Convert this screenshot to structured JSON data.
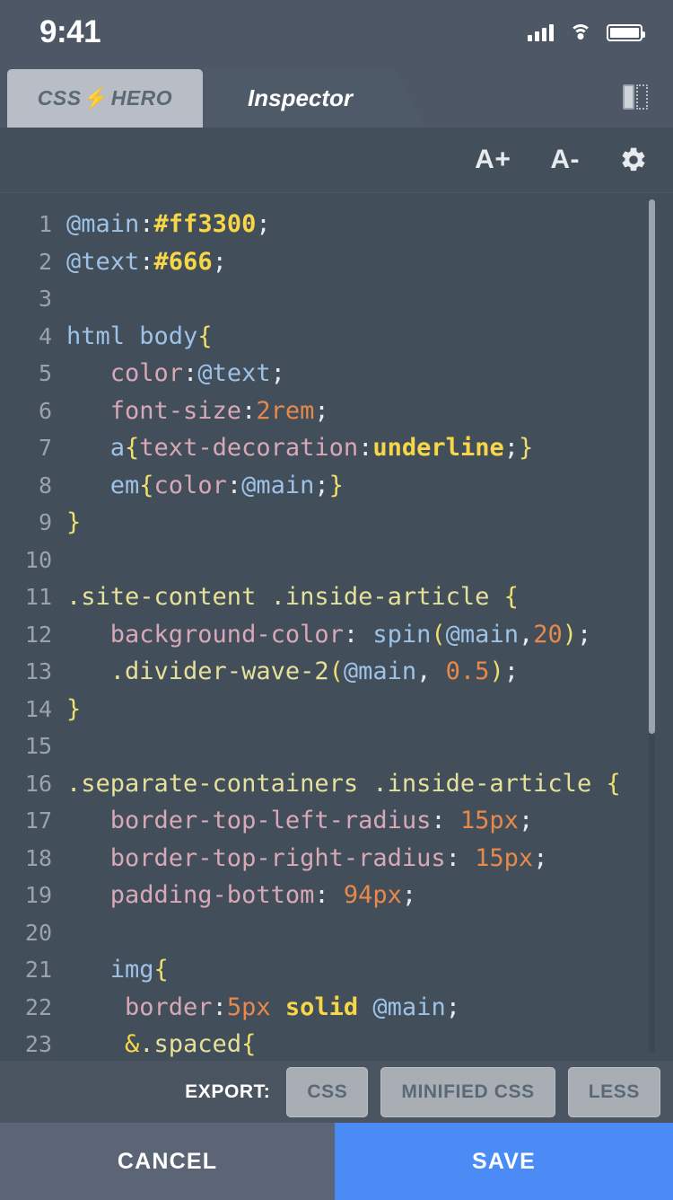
{
  "status_bar": {
    "time": "9:41",
    "icons": [
      "signal-bars-icon",
      "wifi-icon",
      "battery-icon"
    ]
  },
  "tabs": {
    "logo_prefix": "CSS",
    "logo_bolt": "⚡",
    "logo_suffix": "HERO",
    "active_tab": "Inspector",
    "panel_toggle_icon": "panel-layout-icon"
  },
  "toolbar": {
    "font_increase": "A+",
    "font_decrease": "A-",
    "settings_icon": "gear-icon"
  },
  "editor": {
    "lines": [
      {
        "n": "1",
        "tokens": [
          {
            "t": "@main",
            "c": "s-var"
          },
          {
            "t": ":",
            "c": "s-punct"
          },
          {
            "t": "#ff3300",
            "c": "s-hex"
          },
          {
            "t": ";",
            "c": "s-punct"
          }
        ]
      },
      {
        "n": "2",
        "tokens": [
          {
            "t": "@text",
            "c": "s-var"
          },
          {
            "t": ":",
            "c": "s-punct"
          },
          {
            "t": "#666",
            "c": "s-hex"
          },
          {
            "t": ";",
            "c": "s-punct"
          }
        ]
      },
      {
        "n": "3",
        "tokens": []
      },
      {
        "n": "4",
        "tokens": [
          {
            "t": "html body",
            "c": "s-tag"
          },
          {
            "t": "{",
            "c": "s-brace"
          }
        ]
      },
      {
        "n": "5",
        "tokens": [
          {
            "t": "   color",
            "c": "s-prop"
          },
          {
            "t": ":",
            "c": "s-punct"
          },
          {
            "t": "@text",
            "c": "s-var"
          },
          {
            "t": ";",
            "c": "s-punct"
          }
        ]
      },
      {
        "n": "6",
        "tokens": [
          {
            "t": "   font-size",
            "c": "s-prop"
          },
          {
            "t": ":",
            "c": "s-punct"
          },
          {
            "t": "2rem",
            "c": "s-num"
          },
          {
            "t": ";",
            "c": "s-punct"
          }
        ]
      },
      {
        "n": "7",
        "tokens": [
          {
            "t": "   a",
            "c": "s-tag"
          },
          {
            "t": "{",
            "c": "s-brace"
          },
          {
            "t": "text-decoration",
            "c": "s-prop"
          },
          {
            "t": ":",
            "c": "s-punct"
          },
          {
            "t": "underline",
            "c": "s-kw"
          },
          {
            "t": ";",
            "c": "s-punct"
          },
          {
            "t": "}",
            "c": "s-brace"
          }
        ]
      },
      {
        "n": "8",
        "tokens": [
          {
            "t": "   em",
            "c": "s-tag"
          },
          {
            "t": "{",
            "c": "s-brace"
          },
          {
            "t": "color",
            "c": "s-prop"
          },
          {
            "t": ":",
            "c": "s-punct"
          },
          {
            "t": "@main",
            "c": "s-var"
          },
          {
            "t": ";",
            "c": "s-punct"
          },
          {
            "t": "}",
            "c": "s-brace"
          }
        ]
      },
      {
        "n": "9",
        "tokens": [
          {
            "t": "}",
            "c": "s-brace"
          }
        ]
      },
      {
        "n": "10",
        "tokens": []
      },
      {
        "n": "11",
        "tokens": [
          {
            "t": ".site-content .inside-article ",
            "c": "s-sel"
          },
          {
            "t": "{",
            "c": "s-brace"
          }
        ]
      },
      {
        "n": "12",
        "tokens": [
          {
            "t": "   background-color",
            "c": "s-prop"
          },
          {
            "t": ": ",
            "c": "s-punct"
          },
          {
            "t": "spin",
            "c": "s-fn"
          },
          {
            "t": "(",
            "c": "s-brace"
          },
          {
            "t": "@main",
            "c": "s-var"
          },
          {
            "t": ",",
            "c": "s-punct"
          },
          {
            "t": "20",
            "c": "s-num"
          },
          {
            "t": ")",
            "c": "s-brace"
          },
          {
            "t": ";",
            "c": "s-punct"
          }
        ]
      },
      {
        "n": "13",
        "tokens": [
          {
            "t": "   .divider-wave-2",
            "c": "s-sel"
          },
          {
            "t": "(",
            "c": "s-brace"
          },
          {
            "t": "@main",
            "c": "s-var"
          },
          {
            "t": ", ",
            "c": "s-punct"
          },
          {
            "t": "0.5",
            "c": "s-num"
          },
          {
            "t": ")",
            "c": "s-brace"
          },
          {
            "t": ";",
            "c": "s-punct"
          }
        ]
      },
      {
        "n": "14",
        "tokens": [
          {
            "t": "}",
            "c": "s-brace"
          }
        ]
      },
      {
        "n": "15",
        "tokens": []
      },
      {
        "n": "16",
        "tokens": [
          {
            "t": ".separate-containers .inside-article ",
            "c": "s-sel"
          },
          {
            "t": "{",
            "c": "s-brace"
          }
        ]
      },
      {
        "n": "17",
        "tokens": [
          {
            "t": "   border-top-left-radius",
            "c": "s-prop"
          },
          {
            "t": ": ",
            "c": "s-punct"
          },
          {
            "t": "15px",
            "c": "s-num"
          },
          {
            "t": ";",
            "c": "s-punct"
          }
        ]
      },
      {
        "n": "18",
        "tokens": [
          {
            "t": "   border-top-right-radius",
            "c": "s-prop"
          },
          {
            "t": ": ",
            "c": "s-punct"
          },
          {
            "t": "15px",
            "c": "s-num"
          },
          {
            "t": ";",
            "c": "s-punct"
          }
        ]
      },
      {
        "n": "19",
        "tokens": [
          {
            "t": "   padding-bottom",
            "c": "s-prop"
          },
          {
            "t": ": ",
            "c": "s-punct"
          },
          {
            "t": "94px",
            "c": "s-num"
          },
          {
            "t": ";",
            "c": "s-punct"
          }
        ]
      },
      {
        "n": "20",
        "tokens": []
      },
      {
        "n": "21",
        "tokens": [
          {
            "t": "   img",
            "c": "s-tag"
          },
          {
            "t": "{",
            "c": "s-brace"
          }
        ]
      },
      {
        "n": "22",
        "tokens": [
          {
            "t": "    border",
            "c": "s-prop"
          },
          {
            "t": ":",
            "c": "s-punct"
          },
          {
            "t": "5px",
            "c": "s-num"
          },
          {
            "t": " ",
            "c": "s-punct"
          },
          {
            "t": "solid",
            "c": "s-kw"
          },
          {
            "t": " ",
            "c": "s-punct"
          },
          {
            "t": "@main",
            "c": "s-var"
          },
          {
            "t": ";",
            "c": "s-punct"
          }
        ]
      },
      {
        "n": "23",
        "tokens": [
          {
            "t": "    &",
            "c": "s-amp"
          },
          {
            "t": ".spaced",
            "c": "s-sel"
          },
          {
            "t": "{",
            "c": "s-brace"
          }
        ]
      }
    ]
  },
  "export_bar": {
    "label": "EXPORT:",
    "buttons": [
      "CSS",
      "MINIFIED CSS",
      "LESS"
    ]
  },
  "action_bar": {
    "cancel": "CANCEL",
    "save": "SAVE"
  },
  "colors": {
    "accent_blue": "#4a8bf5",
    "editor_bg": "#424f5a",
    "chrome_bg": "#4d5765",
    "export_btn": "#a9aeb5"
  }
}
